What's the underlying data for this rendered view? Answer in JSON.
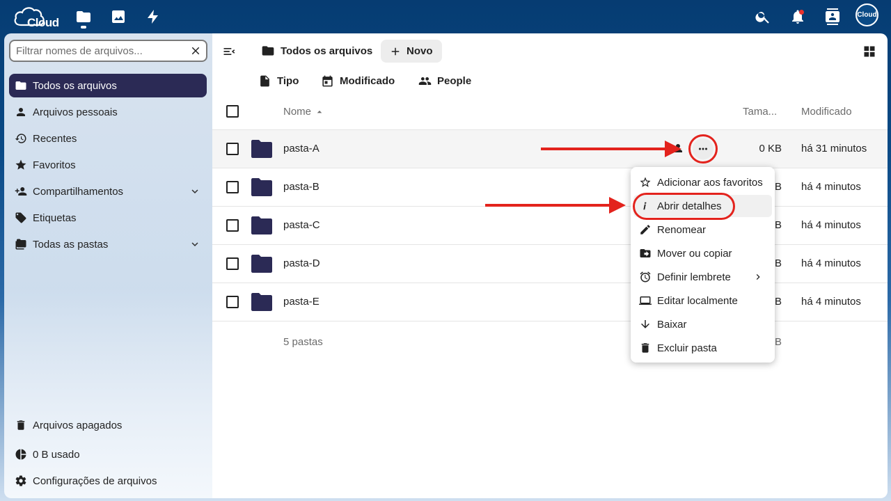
{
  "topbar": {
    "logo_text": "Cloud",
    "apps": [
      {
        "name": "files",
        "icon": "folder-icon"
      },
      {
        "name": "photos",
        "icon": "image-icon"
      },
      {
        "name": "activity",
        "icon": "bolt-icon"
      }
    ],
    "avatar_text": "Cloud",
    "notification_color": "#e9322d"
  },
  "sidebar": {
    "filter_placeholder": "Filtrar nomes de arquivos...",
    "items": [
      {
        "label": "Todos os arquivos",
        "icon": "folder-icon",
        "active": true
      },
      {
        "label": "Arquivos pessoais",
        "icon": "person-icon"
      },
      {
        "label": "Recentes",
        "icon": "history-icon"
      },
      {
        "label": "Favoritos",
        "icon": "star-icon"
      },
      {
        "label": "Compartilhamentos",
        "icon": "share-icon",
        "expandable": true
      },
      {
        "label": "Etiquetas",
        "icon": "tag-icon"
      },
      {
        "label": "Todas as pastas",
        "icon": "folders-icon",
        "expandable": true
      }
    ],
    "bottom": {
      "trash": "Arquivos apagados",
      "usage": "0 B usado",
      "settings": "Configurações de arquivos"
    }
  },
  "main": {
    "breadcrumb": "Todos os arquivos",
    "new_button": "Novo",
    "filters": [
      "Tipo",
      "Modificado",
      "People"
    ],
    "columns": {
      "name": "Nome",
      "size": "Tama...",
      "modified": "Modificado"
    },
    "rows": [
      {
        "name": "pasta-A",
        "size": "0 KB",
        "modified": "há 31 minutos"
      },
      {
        "name": "pasta-B",
        "size": "0 KB",
        "modified": "há 4 minutos"
      },
      {
        "name": "pasta-C",
        "size": "0 KB",
        "modified": "há 4 minutos"
      },
      {
        "name": "pasta-D",
        "size": "0 KB",
        "modified": "há 4 minutos"
      },
      {
        "name": "pasta-E",
        "size": "0 KB",
        "modified": "há 4 minutos"
      }
    ],
    "summary": "5 pastas",
    "summary_size": "0 KB"
  },
  "menu": {
    "items": [
      {
        "label": "Adicionar aos favoritos",
        "icon": "star-outline-icon"
      },
      {
        "label": "Abrir detalhes",
        "icon": "info-icon"
      },
      {
        "label": "Renomear",
        "icon": "pencil-icon"
      },
      {
        "label": "Mover ou copiar",
        "icon": "folder-move-icon"
      },
      {
        "label": "Definir lembrete",
        "icon": "alarm-icon",
        "submenu": true
      },
      {
        "label": "Editar localmente",
        "icon": "laptop-icon"
      },
      {
        "label": "Baixar",
        "icon": "download-icon"
      },
      {
        "label": "Excluir pasta",
        "icon": "trash-icon"
      }
    ]
  },
  "colors": {
    "brand_dark": "#2b2a55",
    "annotation_red": "#e3231d",
    "header_blue": "#0a4a86"
  }
}
